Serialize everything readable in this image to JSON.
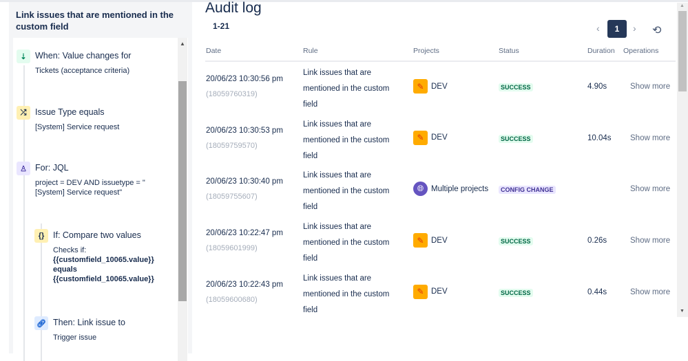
{
  "rule_panel": {
    "title": "Link issues that are mentioned in the custom field",
    "steps": [
      {
        "icon": "trigger-icon",
        "heading": "When: Value changes for",
        "detail": "Tickets (acceptance criteria)"
      },
      {
        "icon": "shuffle-icon",
        "heading": "Issue Type equals",
        "detail": "[System] Service request"
      },
      {
        "icon": "branch-icon",
        "heading": "For: JQL",
        "detail_lines": [
          "project = DEV AND issuetype = \"",
          "[System] Service request\""
        ]
      },
      {
        "icon": "braces-icon",
        "heading": "If: Compare two values",
        "detail": "Checks if:",
        "bold_lines": [
          "{{customfield_10065.value}}",
          "equals",
          "{{customfield_10065.value}}"
        ]
      },
      {
        "icon": "link-icon",
        "heading": "Then: Link issue to",
        "detail": "Trigger issue"
      }
    ]
  },
  "audit": {
    "title": "Audit log",
    "range": "1-21",
    "current_page": "1",
    "columns": [
      "Date",
      "Rule",
      "Projects",
      "Status",
      "Duration",
      "Operations"
    ],
    "rows": [
      {
        "date": "20/06/23 10:30:56 pm",
        "id": "(18059760319)",
        "rule": "Link issues that are mentioned in the custom field",
        "project": "DEV",
        "status": "SUCCESS",
        "duration": "4.90s",
        "op": "Show more"
      },
      {
        "date": "20/06/23 10:30:53 pm",
        "id": "(18059759570)",
        "rule": "Link issues that are mentioned in the custom field",
        "project": "DEV",
        "status": "SUCCESS",
        "duration": "10.04s",
        "op": "Show more"
      },
      {
        "date": "20/06/23 10:30:40 pm",
        "id": "(18059755607)",
        "rule": "Link issues that are mentioned in the custom field",
        "project": "Multiple projects",
        "status": "CONFIG CHANGE",
        "duration": "",
        "op": "Show more"
      },
      {
        "date": "20/06/23 10:22:47 pm",
        "id": "(18059601999)",
        "rule": "Link issues that are mentioned in the custom field",
        "project": "DEV",
        "status": "SUCCESS",
        "duration": "0.26s",
        "op": "Show more"
      },
      {
        "date": "20/06/23 10:22:43 pm",
        "id": "(18059600680)",
        "rule": "Link issues that are mentioned in the custom field",
        "project": "DEV",
        "status": "SUCCESS",
        "duration": "0.44s",
        "op": "Show more"
      }
    ]
  },
  "colors": {
    "success_bg": "#e3fcef",
    "success_fg": "#006644",
    "config_bg": "#eae6ff",
    "config_fg": "#403294",
    "page_btn": "#253858"
  }
}
